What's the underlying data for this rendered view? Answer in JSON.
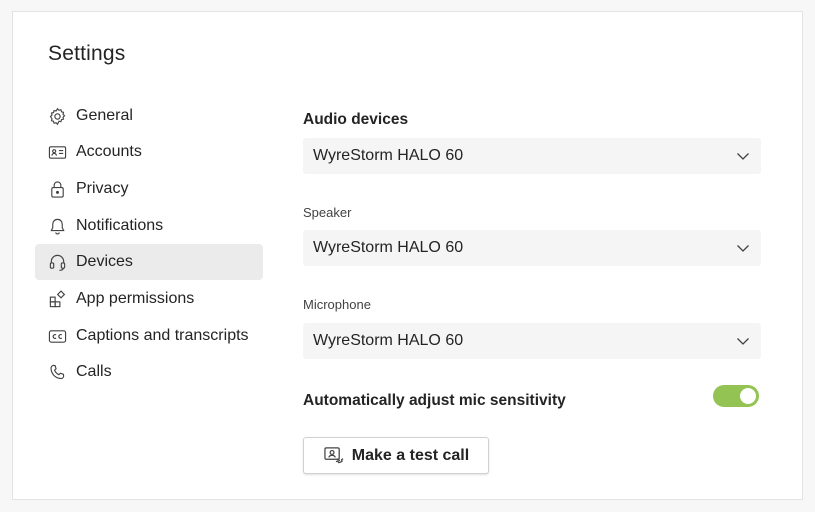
{
  "window": {
    "title": "Settings"
  },
  "sidebar": {
    "items": [
      {
        "label": "General",
        "icon": "gear-icon"
      },
      {
        "label": "Accounts",
        "icon": "id-card-icon"
      },
      {
        "label": "Privacy",
        "icon": "lock-icon"
      },
      {
        "label": "Notifications",
        "icon": "bell-icon"
      },
      {
        "label": "Devices",
        "icon": "headset-icon",
        "selected": true
      },
      {
        "label": "App permissions",
        "icon": "app-grid-icon"
      },
      {
        "label": "Captions and transcripts",
        "icon": "closed-captions-icon"
      },
      {
        "label": "Calls",
        "icon": "phone-icon"
      }
    ]
  },
  "devices": {
    "audio_heading": "Audio devices",
    "audio_value": "WyreStorm HALO 60",
    "speaker_label": "Speaker",
    "speaker_value": "WyreStorm HALO 60",
    "microphone_label": "Microphone",
    "microphone_value": "WyreStorm HALO 60",
    "mic_sensitivity_label": "Automatically adjust mic sensitivity",
    "mic_sensitivity_on": true,
    "test_call_label": "Make a test call"
  },
  "colors": {
    "toggle_on": "#92c353",
    "selected_bg": "#ebebeb",
    "dropdown_bg": "#f5f5f5"
  }
}
